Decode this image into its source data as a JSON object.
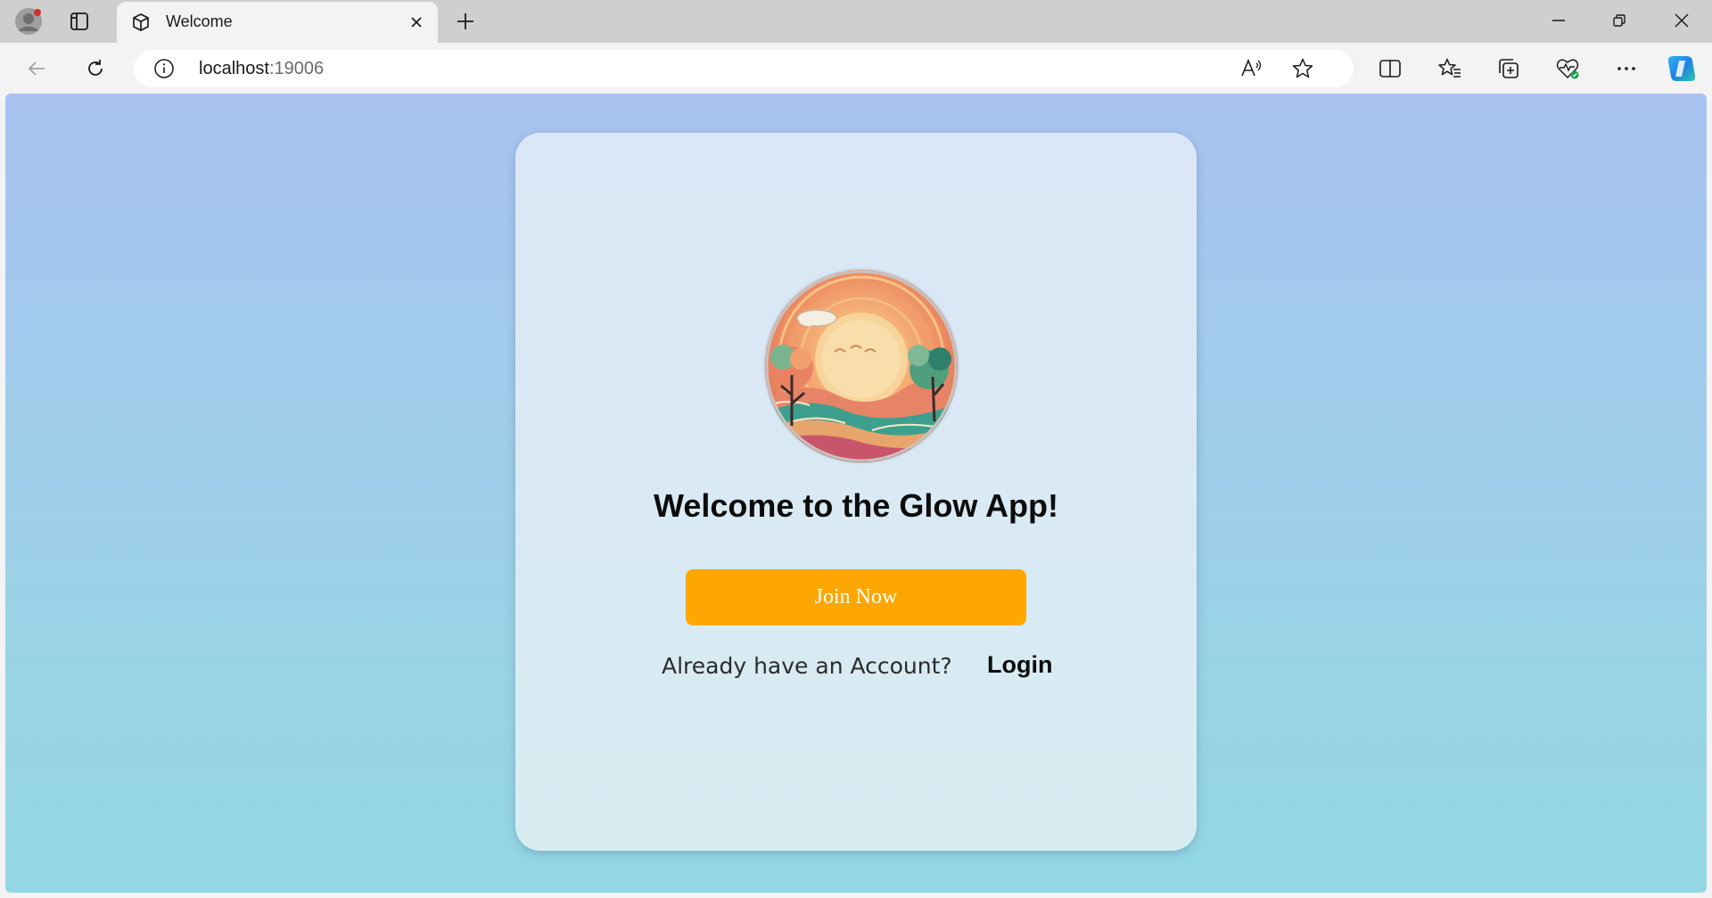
{
  "browser": {
    "tab": {
      "title": "Welcome"
    },
    "address": {
      "host": "localhost",
      "port": ":19006"
    }
  },
  "page": {
    "heading": "Welcome to the Glow App!",
    "join_label": "Join Now",
    "account_prompt": "Already have an Account?",
    "login_label": "Login"
  },
  "colors": {
    "background_top": "#a8c3f0",
    "background_bottom": "#92d7e3",
    "card": "#dbe7f7",
    "join_button": "#fea702"
  }
}
